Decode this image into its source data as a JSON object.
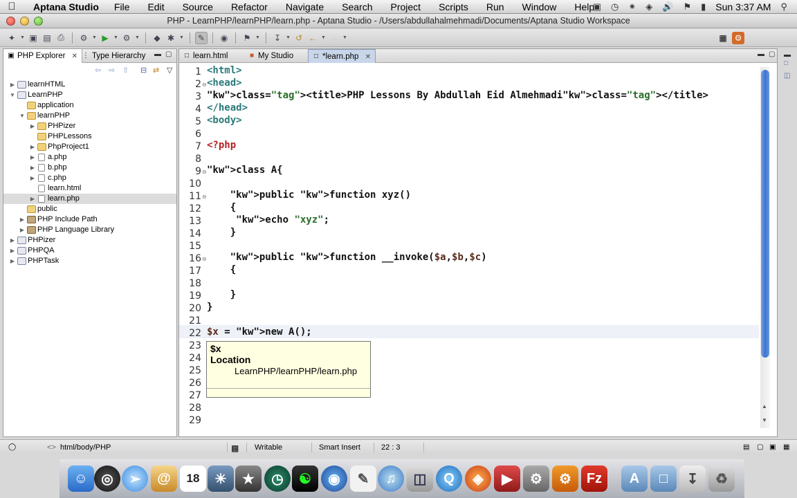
{
  "menubar": {
    "app": "Aptana Studio",
    "items": [
      "File",
      "Edit",
      "Source",
      "Refactor",
      "Navigate",
      "Search",
      "Project",
      "Scripts",
      "Run",
      "Window",
      "Help"
    ],
    "clock": "Sun 3:37 AM"
  },
  "window": {
    "title": "PHP - LearnPHP/learnPHP/learn.php - Aptana Studio - /Users/abdullahalmehmadi/Documents/Aptana Studio Workspace"
  },
  "left_panel": {
    "tabs": [
      {
        "label": "PHP Explorer",
        "icon": "php-explorer-icon"
      },
      {
        "label": "Type Hierarchy",
        "icon": "hierarchy-icon"
      }
    ],
    "tree": [
      {
        "label": "learnHTML",
        "type": "project",
        "expanded": false
      },
      {
        "label": "LearnPHP",
        "type": "project",
        "expanded": true
      },
      {
        "label": "application",
        "type": "folder"
      },
      {
        "label": "learnPHP",
        "type": "folder",
        "expanded": true
      },
      {
        "label": "PHPizer",
        "type": "folder",
        "expanded": false
      },
      {
        "label": "PHPLessons",
        "type": "folder"
      },
      {
        "label": "PhpProject1",
        "type": "folder",
        "expanded": false
      },
      {
        "label": "a.php",
        "type": "file",
        "expanded": false
      },
      {
        "label": "b.php",
        "type": "file",
        "expanded": false
      },
      {
        "label": "c.php",
        "type": "file",
        "expanded": false
      },
      {
        "label": "learn.html",
        "type": "file"
      },
      {
        "label": "learn.php",
        "type": "file",
        "expanded": false,
        "selected": true
      },
      {
        "label": "public",
        "type": "folder"
      },
      {
        "label": "PHP Include Path",
        "type": "library",
        "expanded": false
      },
      {
        "label": "PHP Language Library",
        "type": "library",
        "expanded": false
      },
      {
        "label": "PHPizer",
        "type": "project",
        "expanded": false
      },
      {
        "label": "PHPQA",
        "type": "project",
        "expanded": false
      },
      {
        "label": "PHPTask",
        "type": "project",
        "expanded": false
      }
    ]
  },
  "editor": {
    "tabs": [
      {
        "label": "learn.html",
        "active": false
      },
      {
        "label": "My Studio",
        "active": false
      },
      {
        "label": "*learn.php",
        "active": true
      }
    ],
    "line_numbers": [
      "1",
      "2",
      "3",
      "4",
      "5",
      "6",
      "7",
      "8",
      "9",
      "10",
      "11",
      "12",
      "13",
      "14",
      "15",
      "16",
      "17",
      "18",
      "19",
      "20",
      "21",
      "22",
      "23",
      "24",
      "25",
      "26",
      "27",
      "28",
      "29"
    ],
    "lines": [
      "<html>",
      "<head>",
      "<title>PHP Lessons By Abdullah Eid Almehmadi</title>",
      "</head>",
      "<body>",
      "",
      "<?php",
      "",
      "class A{",
      "",
      "    public function xyz()",
      "    {",
      "     echo \"xyz\";",
      "    }",
      "",
      "    public function __invoke($a,$b,$c)",
      "    {",
      "",
      "    }",
      "}",
      "",
      "$x = new A();",
      "",
      "",
      "",
      "",
      "",
      "",
      ""
    ],
    "hover": {
      "variable": "$x",
      "heading": "Location",
      "path": "LearnPHP/learnPHP/learn.php"
    }
  },
  "statusbar": {
    "breadcrumb": "html/body/PHP",
    "mode": "Writable",
    "insert": "Smart Insert",
    "position": "22 : 3"
  },
  "dock": {
    "apps": [
      "finder-icon",
      "dashboard-icon",
      "safari-icon",
      "address-book-icon",
      "calendar-icon",
      "iphoto-icon",
      "imovie-icon",
      "time-machine-icon",
      "zoin-icon",
      "network-icon",
      "textedit-icon",
      "itunes-icon",
      "preview-icon",
      "quicktime-icon",
      "firefox-icon",
      "video-icon",
      "utility-icon",
      "gear-icon",
      "filezilla-icon",
      "applications-folder-icon",
      "documents-folder-icon",
      "downloads-icon",
      "trash-icon"
    ],
    "calendar_day": "18"
  }
}
